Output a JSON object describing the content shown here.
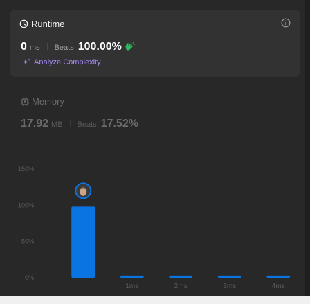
{
  "runtime": {
    "title": "Runtime",
    "value": "0",
    "unit": "ms",
    "beats_label": "Beats",
    "beats_value": "100.00%",
    "analyze_label": "Analyze Complexity"
  },
  "memory": {
    "title": "Memory",
    "value": "17.92",
    "unit": "MB",
    "beats_label": "Beats",
    "beats_value": "17.52%"
  },
  "colors": {
    "bar": "#0a74e3",
    "accent_purple": "#a78bfa",
    "hand_green": "#2cbb5d"
  },
  "chart_data": {
    "type": "bar",
    "categories": [
      "",
      "1ms",
      "2ms",
      "3ms",
      "4ms"
    ],
    "values": [
      98,
      3,
      3,
      3,
      3
    ],
    "y_ticks": [
      "0%",
      "50%",
      "100%",
      "150%"
    ],
    "ylim": [
      0,
      150
    ],
    "grid": false,
    "highlighted_index": 0,
    "marker_icon": "avatar"
  }
}
